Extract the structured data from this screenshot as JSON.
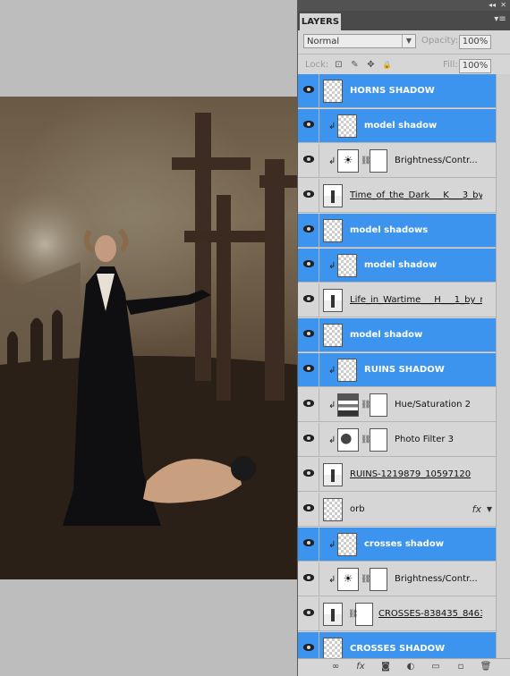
{
  "panel": {
    "title": "LAYERS",
    "collapse_glyph": "◂◂",
    "close_glyph": "✕",
    "menu_glyph": "▾≡",
    "blend_mode": "Normal",
    "opacity_label": "Opacity:",
    "opacity_value": "100%",
    "lock_label": "Lock:",
    "fill_label": "Fill:",
    "fill_value": "100%"
  },
  "icons": {
    "lock_transparent": "⊡",
    "lock_image": "✎",
    "lock_position": "✥",
    "lock_all": "🔒",
    "chain": "⛓",
    "clip": "↲",
    "brightness": "☀",
    "fx": "fx"
  },
  "layers": [
    {
      "name": "HORNS SHADOW",
      "selected": true,
      "clipped": false,
      "kind": "pixel"
    },
    {
      "name": "model shadow",
      "selected": true,
      "clipped": true,
      "kind": "pixel"
    },
    {
      "name": "Brightness/Contr...",
      "selected": false,
      "clipped": true,
      "kind": "adjust-brightness"
    },
    {
      "name": "Time_of_the_Dark___K___3_by...",
      "selected": false,
      "clipped": false,
      "kind": "image",
      "underline": true
    },
    {
      "name": "model shadows",
      "selected": true,
      "clipped": false,
      "kind": "pixel"
    },
    {
      "name": "model shadow",
      "selected": true,
      "clipped": true,
      "kind": "pixel"
    },
    {
      "name": "Life_in_Wartime___H___1_by_m...",
      "selected": false,
      "clipped": false,
      "kind": "image",
      "underline": true
    },
    {
      "name": "model shadow",
      "selected": true,
      "clipped": false,
      "kind": "pixel"
    },
    {
      "name": "RUINS SHADOW",
      "selected": true,
      "clipped": true,
      "kind": "pixel"
    },
    {
      "name": "Hue/Saturation 2",
      "selected": false,
      "clipped": true,
      "kind": "adjust-hue"
    },
    {
      "name": "Photo Filter 3",
      "selected": false,
      "clipped": true,
      "kind": "adjust-photo"
    },
    {
      "name": "RUINS-1219879_10597120",
      "selected": false,
      "clipped": false,
      "kind": "image",
      "underline": true
    },
    {
      "name": "orb",
      "selected": false,
      "clipped": false,
      "kind": "pixel-fx"
    },
    {
      "name": "crosses shadow",
      "selected": true,
      "clipped": true,
      "kind": "pixel"
    },
    {
      "name": "Brightness/Contr...",
      "selected": false,
      "clipped": true,
      "kind": "adjust-brightness"
    },
    {
      "name": "CROSSES-838435_8463...",
      "selected": false,
      "clipped": false,
      "kind": "image-mask",
      "underline": true
    },
    {
      "name": "CROSSES SHADOW",
      "selected": true,
      "clipped": false,
      "kind": "pixel"
    }
  ],
  "bottom_bar": [
    "link-layers",
    "add-style",
    "add-mask",
    "new-adjustment",
    "new-group",
    "new-layer",
    "delete-layer"
  ],
  "colors": {
    "selection": "#3d94ee",
    "panel_bg": "#d6d6d6",
    "canvas_bg": "#bdbdbd"
  }
}
